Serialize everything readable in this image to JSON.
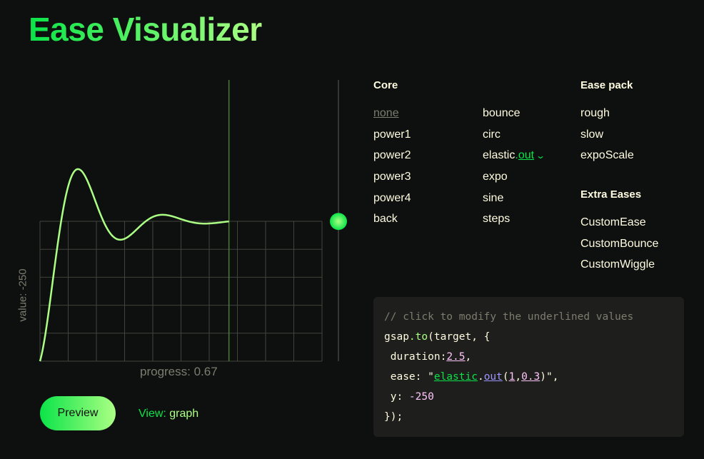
{
  "app": {
    "title": "Ease Visualizer"
  },
  "graph": {
    "ylabel": "value: -250",
    "progress_label": "progress: 0.67",
    "progress": 0.67,
    "ease": {
      "type": "elastic.out",
      "amplitude": 1,
      "period": 0.3
    },
    "colors": {
      "curve": "#abff84",
      "grid": "#42433d",
      "marker": "#4b7a3c",
      "accent": "#0ae448"
    }
  },
  "controls": {
    "preview_label": "Preview",
    "view_key": "View: ",
    "view_value": "graph"
  },
  "eases": {
    "core_heading": "Core",
    "core_col1": [
      "none",
      "power1",
      "power2",
      "power3",
      "power4",
      "back"
    ],
    "core_col2": [
      "bounce",
      "circ",
      "elastic",
      "expo",
      "sine",
      "steps"
    ],
    "elastic_dot": ".",
    "elastic_sub": "out",
    "elastic_chevron": "chevron-down-icon",
    "pack_heading": "Ease pack",
    "pack": [
      "rough",
      "slow",
      "expoScale"
    ],
    "extra_heading": "Extra Eases",
    "extra": [
      "CustomEase",
      "CustomBounce",
      "CustomWiggle"
    ]
  },
  "code": {
    "comment": "// click to modify the underlined values",
    "l2_a": "gsap",
    "l2_b": ".to",
    "l2_c": "(target, {",
    "l3_a": " duration:",
    "l3_b": "2.5",
    "l3_c": ",",
    "l4_a": " ease: \"",
    "l4_b": "elastic",
    "l4_c": ".",
    "l4_d": "out",
    "l4_e": "(",
    "l4_f": "1",
    "l4_g": ",",
    "l4_h": "0.3",
    "l4_i": ")\",",
    "l5_a": " y: ",
    "l5_b": "-250",
    "l6": "});"
  }
}
